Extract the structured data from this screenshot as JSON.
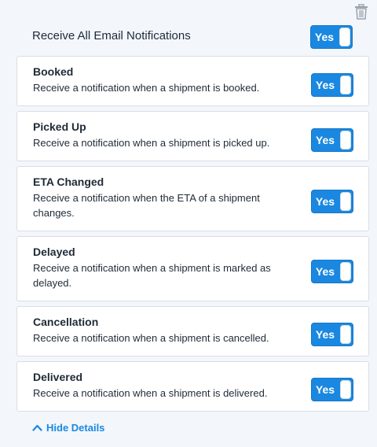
{
  "master": {
    "label": "Receive All Email Notifications",
    "toggle_label": "Yes"
  },
  "cards": [
    {
      "title": "Booked",
      "description": "Receive a notification when a shipment is booked.",
      "toggle_label": "Yes"
    },
    {
      "title": "Picked Up",
      "description": "Receive a notification when a shipment is picked up.",
      "toggle_label": "Yes"
    },
    {
      "title": "ETA Changed",
      "description": "Receive a notification when the ETA of a shipment changes.",
      "toggle_label": "Yes"
    },
    {
      "title": "Delayed",
      "description": "Receive a notification when a shipment is marked as delayed.",
      "toggle_label": "Yes"
    },
    {
      "title": "Cancellation",
      "description": "Receive a notification when a shipment is cancelled.",
      "toggle_label": "Yes"
    },
    {
      "title": "Delivered",
      "description": "Receive a notification when a shipment is delivered.",
      "toggle_label": "Yes"
    }
  ],
  "footer": {
    "hide_details_label": "Hide Details"
  },
  "icons": {
    "delete": "trash-icon",
    "collapse": "chevron-up-icon"
  },
  "colors": {
    "accent": "#1a88e0",
    "background": "#f3f6fb",
    "card_border": "#d9dee5"
  }
}
